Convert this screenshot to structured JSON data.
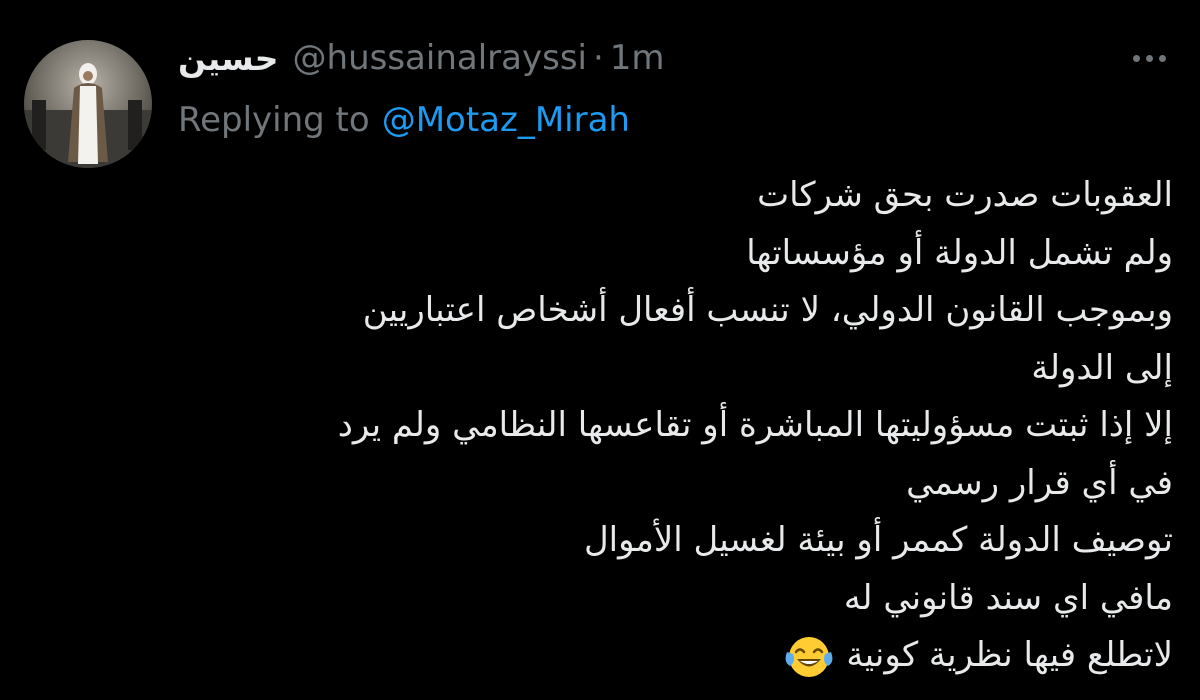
{
  "tweet": {
    "display_name": "حسين",
    "handle": "@hussainalrayssi",
    "separator": "·",
    "time": "1m",
    "reply_label": "Replying to",
    "reply_to": "@Motaz_Mirah",
    "more_icon": "more-horizontal-icon",
    "lines": [
      "العقوبات صدرت بحق شركات",
      "ولم تشمل الدولة أو مؤسساتها",
      "وبموجب القانون الدولي، لا تنسب أفعال أشخاص اعتباريين",
      "إلى الدولة",
      "إلا إذا ثبتت مسؤوليتها المباشرة أو تقاعسها النظامي ولم يرد",
      "في أي قرار رسمي",
      "توصيف الدولة كممر أو بيئة لغسيل الأموال",
      "مافي اي سند قانوني له",
      "لاتطلع فيها نظرية كونية"
    ],
    "emoji": "face-with-tears-of-joy-icon"
  },
  "colors": {
    "background": "#000000",
    "primary_text": "#e7e9ea",
    "secondary_text": "#71767b",
    "link": "#1d9bf0"
  }
}
